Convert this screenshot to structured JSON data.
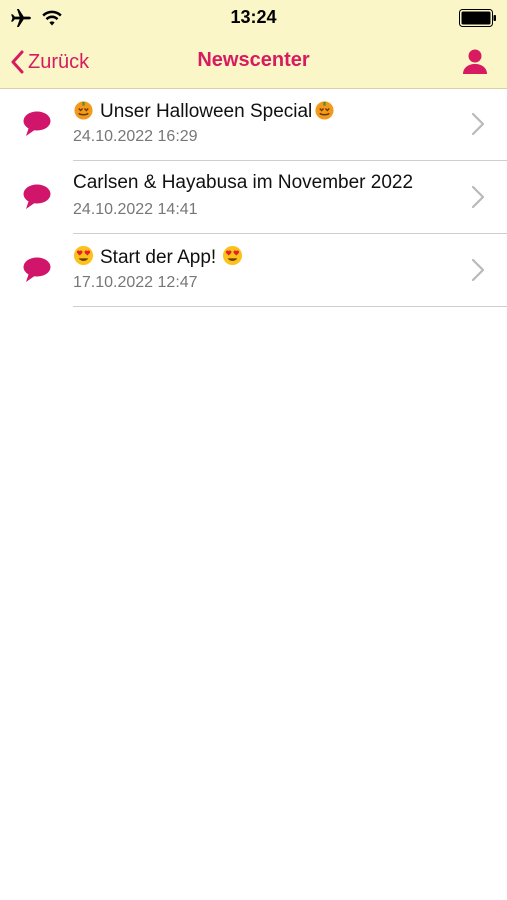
{
  "status_bar": {
    "time": "13:24",
    "icons": [
      "airplane-icon",
      "wifi-icon",
      "battery-icon"
    ]
  },
  "nav": {
    "back_label": "Zurück",
    "title": "Newscenter",
    "icons": [
      "chevron-left-icon",
      "profile-icon"
    ]
  },
  "colors": {
    "accent": "#d81b60",
    "header_bg": "#fbf6c7",
    "date_text": "#777777"
  },
  "news": [
    {
      "title": "Unser Halloween Special",
      "date": "24.10.2022 16:29",
      "emoji": "pumpkin-icon"
    },
    {
      "title": "Carlsen & Hayabusa im November 2022",
      "date": "24.10.2022 14:41",
      "emoji": ""
    },
    {
      "title": "Start der App!",
      "date": "17.10.2022 12:47",
      "emoji": "heart-eyes-icon"
    }
  ]
}
